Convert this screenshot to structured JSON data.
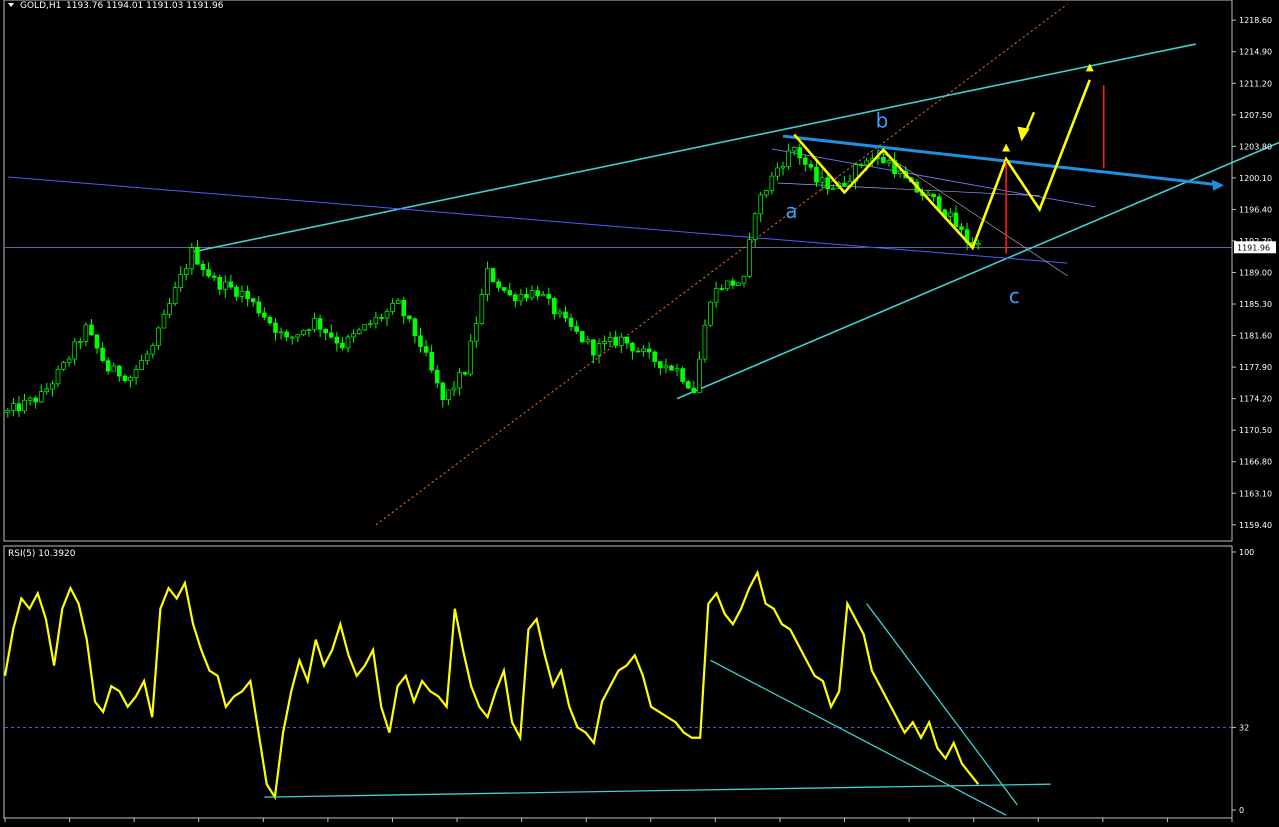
{
  "chart_data": [
    {
      "type": "candlestick",
      "symbol_label": "GOLD,H1",
      "ohlc_readout": "1193.76 1194.01 1191.03 1191.96",
      "ylim": [
        1157.5,
        1220.5
      ],
      "price_ticks": [
        "1218.60",
        "1214.90",
        "1211.20",
        "1207.50",
        "1203.80",
        "1200.10",
        "1196.40",
        "1192.70",
        "1189.00",
        "1185.30",
        "1181.60",
        "1177.90",
        "1174.20",
        "1170.50",
        "1166.80",
        "1163.10",
        "1159.40"
      ],
      "current_price": "1191.96",
      "bar_count": 220,
      "colors": {
        "bull": "#00ff00",
        "bear": "#00ff00",
        "grid": "#4a4a4a",
        "axis": "#c0c0c0"
      },
      "price_path": [
        [
          0,
          1172.6
        ],
        [
          6,
          1174.5
        ],
        [
          10,
          1178.0
        ],
        [
          14,
          1182.4
        ],
        [
          18,
          1177.6
        ],
        [
          22,
          1176.8
        ],
        [
          26,
          1180.2
        ],
        [
          30,
          1186.8
        ],
        [
          33,
          1191.4
        ],
        [
          37,
          1188.0
        ],
        [
          42,
          1186.6
        ],
        [
          46,
          1184.0
        ],
        [
          50,
          1181.0
        ],
        [
          55,
          1183.3
        ],
        [
          60,
          1180.5
        ],
        [
          65,
          1183.0
        ],
        [
          70,
          1185.2
        ],
        [
          74,
          1180.6
        ],
        [
          78,
          1174.0
        ],
        [
          82,
          1177.5
        ],
        [
          86,
          1189.0
        ],
        [
          90,
          1186.2
        ],
        [
          95,
          1186.8
        ],
        [
          100,
          1183.0
        ],
        [
          105,
          1180.0
        ],
        [
          110,
          1181.2
        ],
        [
          115,
          1179.0
        ],
        [
          120,
          1177.6
        ],
        [
          123,
          1175.2
        ],
        [
          126,
          1186.2
        ],
        [
          128,
          1187.5
        ],
        [
          132,
          1188.0
        ],
        [
          134,
          1196.5
        ],
        [
          138,
          1201.3
        ],
        [
          141,
          1203.7
        ],
        [
          145,
          1199.7
        ],
        [
          149,
          1199.0
        ],
        [
          154,
          1202.5
        ],
        [
          158,
          1202.0
        ],
        [
          162,
          1199.0
        ],
        [
          167,
          1197.0
        ],
        [
          172,
          1192.8
        ],
        [
          174,
          1192.2
        ]
      ],
      "annotations": [
        {
          "label": "a",
          "color": "#3aa0ff"
        },
        {
          "label": "b",
          "color": "#3aa0ff"
        },
        {
          "label": "c",
          "color": "#3aa0ff"
        }
      ],
      "projection_path": [
        [
          141,
          1205.2
        ],
        [
          150,
          1198.4
        ],
        [
          157,
          1203.4
        ],
        [
          173,
          1191.9
        ],
        [
          179,
          1202.3
        ],
        [
          185,
          1196.4
        ],
        [
          194,
          1211.6
        ]
      ]
    },
    {
      "type": "line",
      "title": "RSI(5) 10.3920",
      "ylim": [
        0,
        100
      ],
      "y_ticks": [
        "100",
        "32",
        "0"
      ],
      "level": 32,
      "color": "#ffff00",
      "values": [
        52,
        70,
        82,
        78,
        84,
        74,
        56,
        78,
        86,
        80,
        66,
        42,
        38,
        48,
        46,
        40,
        44,
        50,
        36,
        78,
        86,
        82,
        88,
        72,
        62,
        54,
        52,
        40,
        44,
        46,
        50,
        30,
        10,
        5,
        30,
        46,
        58,
        50,
        66,
        56,
        62,
        72,
        60,
        52,
        56,
        62,
        40,
        30,
        48,
        52,
        42,
        50,
        46,
        44,
        40,
        78,
        62,
        48,
        40,
        36,
        46,
        54,
        34,
        28,
        70,
        74,
        60,
        48,
        54,
        40,
        32,
        30,
        26,
        42,
        48,
        54,
        56,
        60,
        52,
        40,
        38,
        36,
        34,
        30,
        28,
        28,
        80,
        84,
        76,
        72,
        78,
        86,
        92,
        80,
        78,
        72,
        70,
        64,
        58,
        52,
        50,
        40,
        46,
        80,
        74,
        68,
        54,
        48,
        42,
        36,
        30,
        34,
        28,
        34,
        24,
        20,
        26,
        18,
        14,
        10
      ]
    }
  ]
}
